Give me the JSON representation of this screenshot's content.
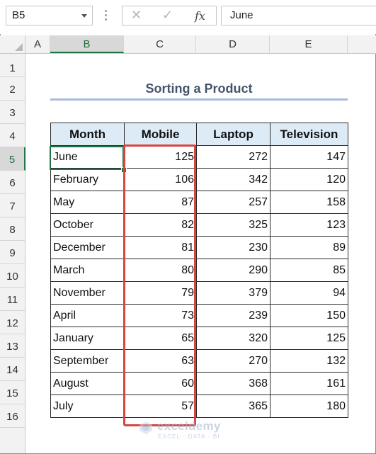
{
  "formula_bar": {
    "name_box": "B5",
    "cancel_icon": "✕",
    "enter_icon": "✓",
    "fx_label": "fx",
    "formula_value": "June"
  },
  "columns": [
    "A",
    "B",
    "C",
    "D",
    "E"
  ],
  "rows": [
    "1",
    "2",
    "3",
    "4",
    "5",
    "6",
    "7",
    "8",
    "9",
    "10",
    "11",
    "12",
    "13",
    "14",
    "15",
    "16"
  ],
  "sheet": {
    "title": "Sorting a Product",
    "headers": [
      "Month",
      "Mobile",
      "Laptop",
      "Television"
    ],
    "data": [
      [
        "June",
        "125",
        "272",
        "147"
      ],
      [
        "February",
        "106",
        "342",
        "120"
      ],
      [
        "May",
        "87",
        "257",
        "158"
      ],
      [
        "October",
        "82",
        "325",
        "123"
      ],
      [
        "December",
        "81",
        "230",
        "89"
      ],
      [
        "March",
        "80",
        "290",
        "85"
      ],
      [
        "November",
        "79",
        "379",
        "94"
      ],
      [
        "April",
        "73",
        "239",
        "150"
      ],
      [
        "January",
        "65",
        "320",
        "125"
      ],
      [
        "September",
        "63",
        "270",
        "132"
      ],
      [
        "August",
        "60",
        "368",
        "161"
      ],
      [
        "July",
        "57",
        "365",
        "180"
      ]
    ]
  },
  "selection": {
    "active_cell": "B5",
    "highlight_color": "#d6453f",
    "accent_color": "#217346"
  },
  "watermark": {
    "brand": "exceldemy",
    "tagline": "EXCEL · DATA · BI"
  }
}
